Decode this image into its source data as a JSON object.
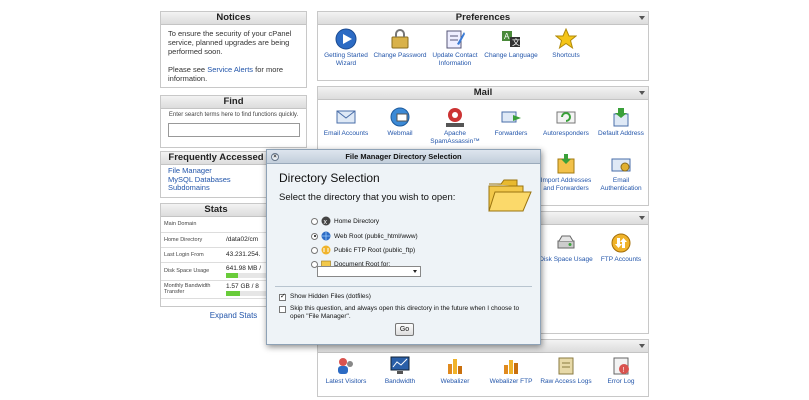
{
  "notices": {
    "title": "Notices",
    "line1": "To ensure the security of your cPanel service, planned upgrades are being performed soon.",
    "line2_prefix": "Please see ",
    "line2_link": "Service Alerts",
    "line2_suffix": " for more information."
  },
  "find": {
    "title": "Find",
    "hint": "Enter search terms here to find functions quickly.",
    "value": "",
    "placeholder": ""
  },
  "frequently_accessed": {
    "title": "Frequently Accessed",
    "items": [
      "File Manager",
      "MySQL Databases",
      "Subdomains"
    ]
  },
  "stats": {
    "title": "Stats",
    "rows": [
      {
        "label": "Main Domain",
        "value": ""
      },
      {
        "label": "Home Directory",
        "value": "/data02/cm"
      },
      {
        "label": "Last Login From",
        "value": "43.231.254."
      },
      {
        "label": "Disk Space Usage",
        "value": "641.98 MB /",
        "fill": 0.3
      },
      {
        "label": "Monthly Bandwidth Transfer",
        "value": "1.57 GB / 8",
        "fill": 0.35
      }
    ],
    "expand_label": "Expand Stats",
    "bar_color": "#69cc3a"
  },
  "preferences": {
    "title": "Preferences",
    "items": [
      {
        "label": "Getting Started Wizard",
        "icon": "wizard-play-icon"
      },
      {
        "label": "Change Password",
        "icon": "password-icon"
      },
      {
        "label": "Update Contact Information",
        "icon": "contact-info-icon"
      },
      {
        "label": "Change Language",
        "icon": "language-icon"
      },
      {
        "label": "Shortcuts",
        "icon": "star-icon"
      }
    ]
  },
  "mail": {
    "title": "Mail",
    "items": [
      {
        "label": "Email Accounts",
        "icon": "email-icon"
      },
      {
        "label": "Webmail",
        "icon": "webmail-icon"
      },
      {
        "label": "Apache SpamAssassin™",
        "icon": "spamassassin-icon"
      },
      {
        "label": "Forwarders",
        "icon": "forwarders-icon"
      },
      {
        "label": "Autoresponders",
        "icon": "autoresponder-icon"
      },
      {
        "label": "Default Address",
        "icon": "default-address-icon"
      },
      {
        "label": "Import Addresses and Forwarders",
        "icon": "import-icon"
      },
      {
        "label": "Email Authentication",
        "icon": "email-auth-icon"
      }
    ]
  },
  "files": {
    "items": [
      {
        "label": "Disk Space Usage",
        "icon": "disk-usage-icon"
      },
      {
        "label": "FTP Accounts",
        "icon": "ftp-accounts-icon"
      }
    ]
  },
  "logs": {
    "items": [
      {
        "label": "Latest Visitors",
        "icon": "visitors-icon"
      },
      {
        "label": "Bandwidth",
        "icon": "bandwidth-icon"
      },
      {
        "label": "Webalizer",
        "icon": "webalizer-icon"
      },
      {
        "label": "Webalizer FTP",
        "icon": "webalizer-ftp-icon"
      },
      {
        "label": "Raw Access Logs",
        "icon": "raw-logs-icon"
      },
      {
        "label": "Error Log",
        "icon": "error-log-icon"
      }
    ]
  },
  "dialog": {
    "title": "File Manager Directory Selection",
    "heading": "Directory Selection",
    "subheading": "Select the directory that you wish to open:",
    "options": [
      {
        "label": "Home Directory",
        "selected": false
      },
      {
        "label": "Web Root (public_html/www)",
        "selected": true
      },
      {
        "label": "Public FTP Root (public_ftp)",
        "selected": false
      },
      {
        "label": "Document Root for:",
        "selected": false
      }
    ],
    "select_value": "",
    "show_hidden": "Show Hidden Files (dotfiles)",
    "skip_question": "Skip this question, and always open this directory in the future when I choose to open \"File Manager\".",
    "go_label": "Go"
  }
}
